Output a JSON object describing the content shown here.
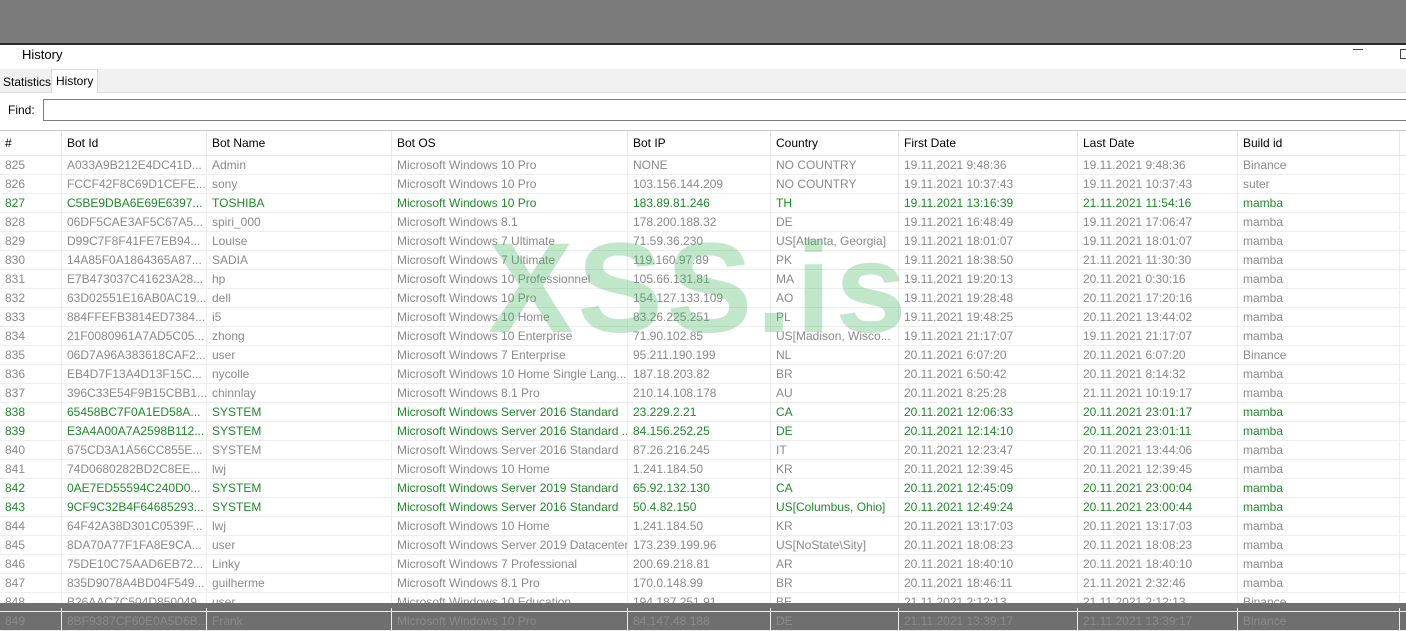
{
  "window": {
    "title": "History"
  },
  "tabs": [
    {
      "label": "Statistics",
      "active": false
    },
    {
      "label": "History",
      "active": true
    }
  ],
  "find": {
    "label": "Find:",
    "value": ""
  },
  "watermark": "XSS.is",
  "colors": {
    "highlight": "#1f8a2a",
    "normal": "#8a8a8a"
  },
  "table": {
    "columns": [
      "#",
      "Bot Id",
      "Bot Name",
      "Bot OS",
      "Bot IP",
      "Country",
      "First Date",
      "Last Date",
      "Build id"
    ],
    "rows": [
      {
        "green": false,
        "cells": [
          "825",
          "A033A9B212E4DC41D...",
          "Admin",
          "Microsoft Windows 10 Pro",
          "NONE",
          "NO COUNTRY",
          "19.11.2021 9:48:36",
          "19.11.2021 9:48:36",
          "Binance"
        ]
      },
      {
        "green": false,
        "cells": [
          "826",
          "FCCF42F8C69D1CEFE...",
          "sony",
          "Microsoft Windows 10 Pro",
          "103.156.144.209",
          "NO COUNTRY",
          "19.11.2021 10:37:43",
          "19.11.2021 10:37:43",
          "suter"
        ]
      },
      {
        "green": true,
        "cells": [
          "827",
          "C5BE9DBA6E69E6397...",
          "TOSHIBA",
          "Microsoft Windows 10 Pro",
          "183.89.81.246",
          "TH",
          "19.11.2021 13:16:39",
          "21.11.2021 11:54:16",
          "mamba"
        ]
      },
      {
        "green": false,
        "cells": [
          "828",
          "06DF5CAE3AF5C67A5...",
          "spiri_000",
          "Microsoft Windows 8.1",
          "178.200.188.32",
          "DE",
          "19.11.2021 16:48:49",
          "19.11.2021 17:06:47",
          "mamba"
        ]
      },
      {
        "green": false,
        "cells": [
          "829",
          "D99C7F8F41FE7EB94...",
          "Louise",
          "Microsoft Windows 7 Ultimate",
          "71.59.36.230",
          "US[Atlanta, Georgia]",
          "19.11.2021 18:01:07",
          "19.11.2021 18:01:07",
          "mamba"
        ]
      },
      {
        "green": false,
        "cells": [
          "830",
          "14A85F0A1864365A87...",
          "SADIA",
          "Microsoft Windows 7 Ultimate",
          "119.160.97.89",
          "PK",
          "19.11.2021 18:38:50",
          "21.11.2021 11:30:30",
          "mamba"
        ]
      },
      {
        "green": false,
        "cells": [
          "831",
          "E7B473037C41623A28...",
          "hp",
          "Microsoft Windows 10 Professionnel",
          "105.66.131.81",
          "MA",
          "19.11.2021 19:20:13",
          "20.11.2021 0:30:16",
          "mamba"
        ]
      },
      {
        "green": false,
        "cells": [
          "832",
          "63D02551E16AB0AC19...",
          "dell",
          "Microsoft Windows 10 Pro",
          "154.127.133.109",
          "AO",
          "19.11.2021 19:28:48",
          "20.11.2021 17:20:16",
          "mamba"
        ]
      },
      {
        "green": false,
        "cells": [
          "833",
          "884FFEFB3814ED7384...",
          "i5",
          "Microsoft Windows 10 Home",
          "83.26.225.251",
          "PL",
          "19.11.2021 19:48:25",
          "20.11.2021 13:44:02",
          "mamba"
        ]
      },
      {
        "green": false,
        "cells": [
          "834",
          "21F0080961A7AD5C05...",
          "zhong",
          "Microsoft Windows 10 Enterprise",
          "71.90.102.85",
          "US[Madison, Wisco...",
          "19.11.2021 21:17:07",
          "19.11.2021 21:17:07",
          "mamba"
        ]
      },
      {
        "green": false,
        "cells": [
          "835",
          "06D7A96A383618CAF2...",
          "user",
          "Microsoft Windows 7 Enterprise",
          "95.211.190.199",
          "NL",
          "20.11.2021 6:07:20",
          "20.11.2021 6:07:20",
          "Binance"
        ]
      },
      {
        "green": false,
        "cells": [
          "836",
          "EB4D7F13A4D13F15C...",
          "nycolle",
          "Microsoft Windows 10 Home Single Lang...",
          "187.18.203.82",
          "BR",
          "20.11.2021 6:50:42",
          "20.11.2021 8:14:32",
          "mamba"
        ]
      },
      {
        "green": false,
        "cells": [
          "837",
          "396C33E54F9B15CBB1...",
          "chinnlay",
          "Microsoft Windows 8.1 Pro",
          "210.14.108.178",
          "AU",
          "20.11.2021 8:25:28",
          "21.11.2021 10:19:17",
          "mamba"
        ]
      },
      {
        "green": true,
        "cells": [
          "838",
          "65458BC7F0A1ED58A...",
          "SYSTEM",
          "Microsoft Windows Server 2016 Standard",
          "23.229.2.21",
          "CA",
          "20.11.2021 12:06:33",
          "20.11.2021 23:01:17",
          "mamba"
        ]
      },
      {
        "green": true,
        "cells": [
          "839",
          "E3A4A00A7A2598B112...",
          "SYSTEM",
          "Microsoft Windows Server 2016 Standard ...",
          "84.156.252.25",
          "DE",
          "20.11.2021 12:14:10",
          "20.11.2021 23:01:11",
          "mamba"
        ]
      },
      {
        "green": false,
        "cells": [
          "840",
          "675CD3A1A56CC855E...",
          "SYSTEM",
          "Microsoft Windows Server 2016 Standard",
          "87.26.216.245",
          "IT",
          "20.11.2021 12:23:47",
          "20.11.2021 13:44:06",
          "mamba"
        ]
      },
      {
        "green": false,
        "cells": [
          "841",
          "74D0680282BD2C8EE...",
          "lwj",
          "Microsoft Windows 10 Home",
          "1.241.184.50",
          "KR",
          "20.11.2021 12:39:45",
          "20.11.2021 12:39:45",
          "mamba"
        ]
      },
      {
        "green": true,
        "cells": [
          "842",
          "0AE7ED55594C240D0...",
          "SYSTEM",
          "Microsoft Windows Server 2019 Standard",
          "65.92.132.130",
          "CA",
          "20.11.2021 12:45:09",
          "20.11.2021 23:00:04",
          "mamba"
        ]
      },
      {
        "green": true,
        "cells": [
          "843",
          "9CF9C32B4F64685293...",
          "SYSTEM",
          "Microsoft Windows Server 2016 Standard",
          "50.4.82.150",
          "US[Columbus, Ohio]",
          "20.11.2021 12:49:24",
          "20.11.2021 23:00:44",
          "mamba"
        ]
      },
      {
        "green": false,
        "cells": [
          "844",
          "64F42A38D301C0539F...",
          "lwj",
          "Microsoft Windows 10 Home",
          "1.241.184.50",
          "KR",
          "20.11.2021 13:17:03",
          "20.11.2021 13:17:03",
          "mamba"
        ]
      },
      {
        "green": false,
        "cells": [
          "845",
          "8DA70A77F1FA8E9CA...",
          "user",
          "Microsoft Windows Server 2019 Datacenter",
          "173.239.199.96",
          "US[NoState\\Sity]",
          "20.11.2021 18:08:23",
          "20.11.2021 18:08:23",
          "mamba"
        ]
      },
      {
        "green": false,
        "cells": [
          "846",
          "75DE10C75AAD6EB72...",
          "Linky",
          "Microsoft Windows 7 Professional",
          "200.69.218.81",
          "AR",
          "20.11.2021 18:40:10",
          "20.11.2021 18:40:10",
          "mamba"
        ]
      },
      {
        "green": false,
        "cells": [
          "847",
          "835D9078A4BD04F549...",
          "guilherme",
          "Microsoft Windows 8.1 Pro",
          "170.0.148.99",
          "BR",
          "20.11.2021 18:46:11",
          "21.11.2021 2:32:46",
          "mamba"
        ]
      },
      {
        "green": false,
        "cells": [
          "848",
          "B26AAC7C504D850049...",
          "user",
          "Microsoft Windows 10 Education",
          "194.187.251.91",
          "BE",
          "21.11.2021 2:12:13",
          "21.11.2021 2:12:13",
          "Binance"
        ]
      },
      {
        "green": false,
        "cells": [
          "849",
          "8BF9387CF60E0A5D6B...",
          "Frank",
          "Microsoft Windows 10 Pro",
          "84.147.48.188",
          "DE",
          "21.11.2021 13:39:17",
          "21.11.2021 13:39:17",
          "Binance"
        ]
      }
    ]
  }
}
